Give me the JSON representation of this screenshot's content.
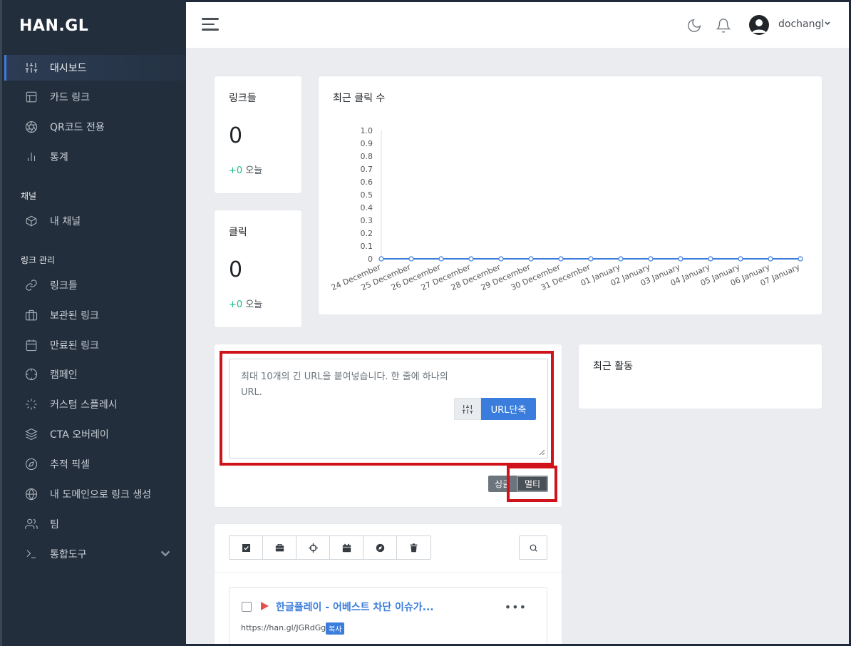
{
  "brand": {
    "logo": "HAN.GL"
  },
  "sidebar": {
    "items": [
      {
        "label": "대시보드",
        "icon": "sliders-icon"
      },
      {
        "label": "카드 링크",
        "icon": "layout-icon"
      },
      {
        "label": "QR코드 전용",
        "icon": "aperture-icon"
      },
      {
        "label": "통계",
        "icon": "bar-chart-icon"
      }
    ],
    "section_channel": "채널",
    "channel_items": [
      {
        "label": "내 채널",
        "icon": "box-icon"
      }
    ],
    "section_links": "링크 관리",
    "link_items": [
      {
        "label": "링크들",
        "icon": "link-icon"
      },
      {
        "label": "보관된 링크",
        "icon": "briefcase-icon"
      },
      {
        "label": "만료된 링크",
        "icon": "calendar-icon"
      },
      {
        "label": "캠페인",
        "icon": "crosshair-icon"
      },
      {
        "label": "커스텀 스플레시",
        "icon": "loader-icon"
      },
      {
        "label": "CTA 오버레이",
        "icon": "layers-icon"
      },
      {
        "label": "추적 픽셀",
        "icon": "compass-icon"
      },
      {
        "label": "내 도메인으로 링크 생성",
        "icon": "globe-icon"
      },
      {
        "label": "팀",
        "icon": "users-icon"
      },
      {
        "label": "통합도구",
        "icon": "terminal-icon"
      }
    ]
  },
  "header": {
    "username": "dochangl"
  },
  "stats": {
    "links": {
      "title": "링크들",
      "value": "0",
      "delta": "+0",
      "today": "오늘"
    },
    "clicks": {
      "title": "클릭",
      "value": "0",
      "delta": "+0",
      "today": "오늘"
    }
  },
  "recent_activity": {
    "title": "최근 활동"
  },
  "shortener": {
    "placeholder": "최대 10개의 긴 URL을 붙여넣습니다. 한 줄에 하나의 URL.",
    "shorten_label": "URL단축",
    "single_label": "싱글",
    "multi_label": "멀티"
  },
  "link_list": {
    "title": "한글플레이 - 어베스트 차단 이슈가...",
    "short_url": "https://han.gl/JGRdGg",
    "copy_label": "복사"
  },
  "chart_data": {
    "type": "line",
    "title": "최근 클릭 수",
    "categories": [
      "24 December",
      "25 December",
      "26 December",
      "27 December",
      "28 December",
      "29 December",
      "30 December",
      "31 December",
      "01 January",
      "02 January",
      "03 January",
      "04 January",
      "05 January",
      "06 January",
      "07 January"
    ],
    "series": [
      {
        "values": [
          0,
          0,
          0,
          0,
          0,
          0,
          0,
          0,
          0,
          0,
          0,
          0,
          0,
          0,
          0
        ]
      }
    ],
    "yticks": [
      "0",
      "0.1",
      "0.2",
      "0.3",
      "0.4",
      "0.5",
      "0.6",
      "0.7",
      "0.8",
      "0.9",
      "1.0"
    ],
    "ylim": [
      0,
      1
    ],
    "color": "#3b7ddd"
  }
}
